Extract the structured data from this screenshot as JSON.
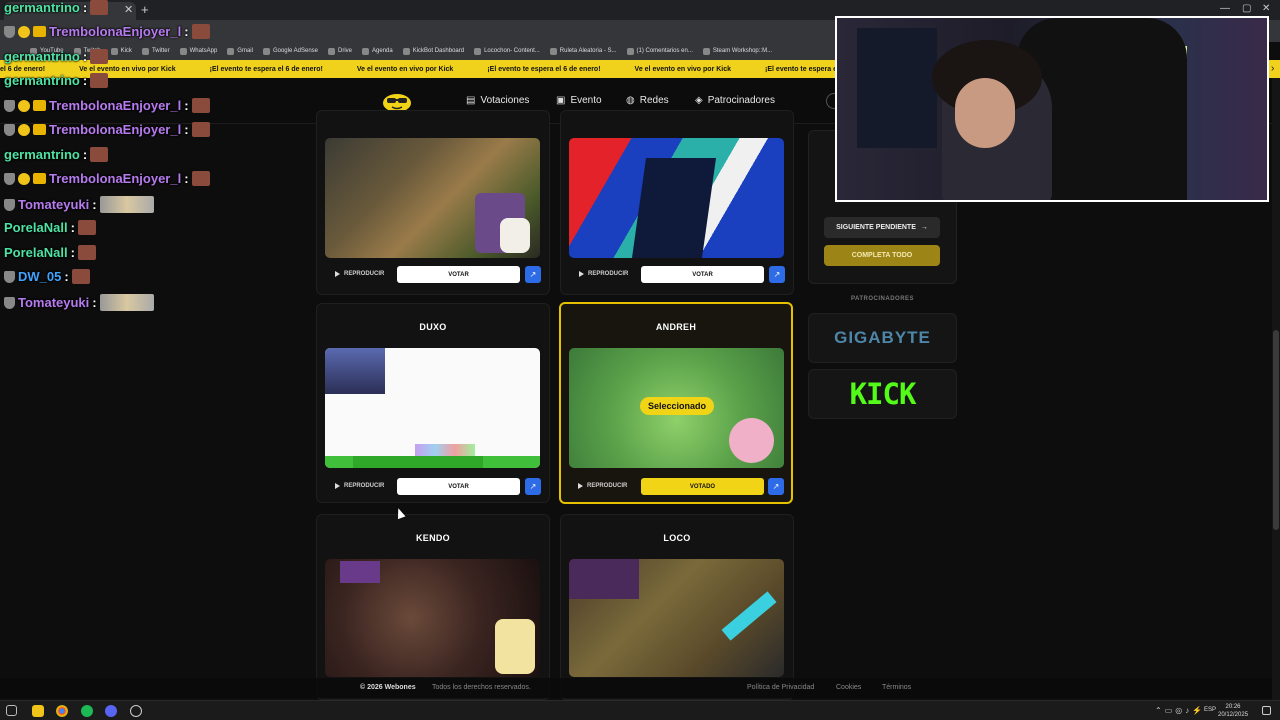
{
  "browser": {
    "bookmarks": [
      "YouTube",
      "Twitch",
      "Kick",
      "Twitter",
      "WhatsApp",
      "Gmail",
      "Google AdSense",
      "Drive",
      "Agenda",
      "KickBot Dashboard",
      "Locochon- Content...",
      "Ruleta Aleatoria - S...",
      "(1) Comentarios en...",
      "Steam Workshop::M..."
    ]
  },
  "banner": {
    "messages": [
      "el 6 de enero!",
      "Ve el evento en vivo por Kick",
      "¡El evento te espera el 6 de enero!",
      "Ve el evento en vivo por Kick",
      "¡El evento te espera el 6 de enero!",
      "Ve el evento en vivo por Kick",
      "¡El evento te espera el 6 de enero!",
      "Ve el evento en vivo por Kick",
      "¡El evento te espera e"
    ]
  },
  "nav": {
    "votaciones": "Votaciones",
    "evento": "Evento",
    "redes": "Redes",
    "patrocinadores": "Patrocinadores"
  },
  "cards": [
    {
      "title": "",
      "play": "REPRODUCIR",
      "vote": "VOTAR"
    },
    {
      "title": "",
      "play": "REPRODUCIR",
      "vote": "VOTAR"
    },
    {
      "title": "DUXO",
      "play": "REPRODUCIR",
      "vote": "VOTAR"
    },
    {
      "title": "ANDREH",
      "play": "REPRODUCIR",
      "vote": "VOTADO",
      "selected_label": "Seleccionado"
    },
    {
      "title": "KENDO"
    },
    {
      "title": "LOCO"
    }
  ],
  "sidebar": {
    "next": "SIGUIENTE PENDIENTE",
    "complete": "COMPLETA TODO",
    "sponsors_title": "PATROCINADORES",
    "sponsor1": "GIGABYTE",
    "sponsor2": "KICK"
  },
  "chat": [
    {
      "user": "germantrino",
      "color": "#4fe3a3"
    },
    {
      "user": "TrembolonaEnjoyer_l",
      "color": "#b77bf0"
    },
    {
      "user": "germantrino",
      "color": "#4fe3a3"
    },
    {
      "user": "germantrino",
      "color": "#4fe3a3"
    },
    {
      "user": "TrembolonaEnjoyer_l",
      "color": "#b77bf0"
    },
    {
      "user": "TrembolonaEnjoyer_l",
      "color": "#b77bf0"
    },
    {
      "user": "germantrino",
      "color": "#4fe3a3"
    },
    {
      "user": "TrembolonaEnjoyer_l",
      "color": "#b77bf0"
    },
    {
      "user": "Tomateyuki",
      "color": "#b77bf0"
    },
    {
      "user": "PorelaNall",
      "color": "#4fe3a3"
    },
    {
      "user": "PorelaNall",
      "color": "#4fe3a3"
    },
    {
      "user": "DW_05",
      "color": "#3fa3ff"
    },
    {
      "user": "Tomateyuki",
      "color": "#b77bf0"
    }
  ],
  "footer": {
    "copyright": "© 2026 Webones",
    "rights": "Todos los derechos reservados.",
    "privacy": "Política de Privacidad",
    "cookies": "Cookies",
    "terms": "Términos"
  },
  "taskbar": {
    "lang": "ESP",
    "time": "20:26",
    "date": "20/12/2025"
  },
  "colors": {
    "accent": "#f2d416",
    "link_button": "#2e6be6",
    "kick_green": "#53fc18"
  }
}
